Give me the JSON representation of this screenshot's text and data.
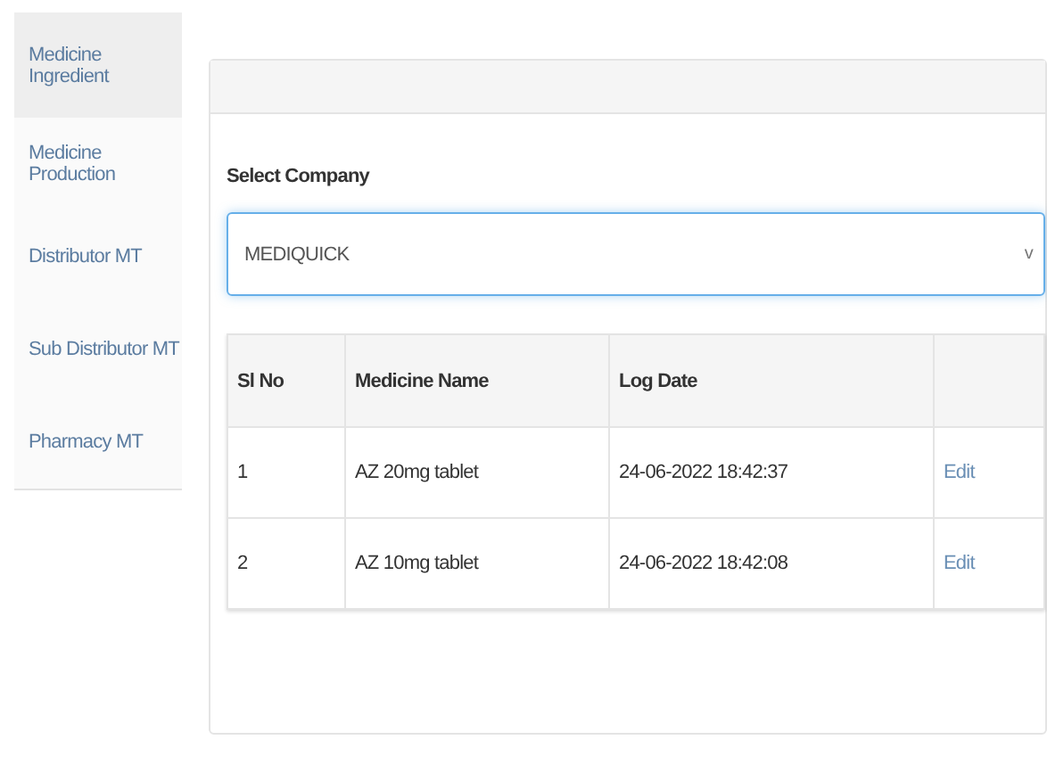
{
  "sidebar": {
    "items": [
      {
        "label": "Medicine Ingredient",
        "selected": true
      },
      {
        "label": "Medicine Production",
        "selected": false
      },
      {
        "label": "Distributor MT",
        "selected": false
      },
      {
        "label": "Sub Distributor MT",
        "selected": false
      },
      {
        "label": "Pharmacy MT",
        "selected": false
      }
    ]
  },
  "form": {
    "label": "Select Company",
    "select": {
      "value": "MEDIQUICK",
      "arrow": "v"
    }
  },
  "table": {
    "columns": [
      "Sl No",
      "Medicine Name",
      "Log Date",
      ""
    ],
    "rows": [
      {
        "cells": [
          "1",
          "AZ 20mg tablet",
          "24-06-2022 18:42:37"
        ],
        "action": "Edit"
      },
      {
        "cells": [
          "2",
          "AZ 10mg tablet",
          "24-06-2022 18:42:08"
        ],
        "action": "Edit"
      }
    ]
  }
}
